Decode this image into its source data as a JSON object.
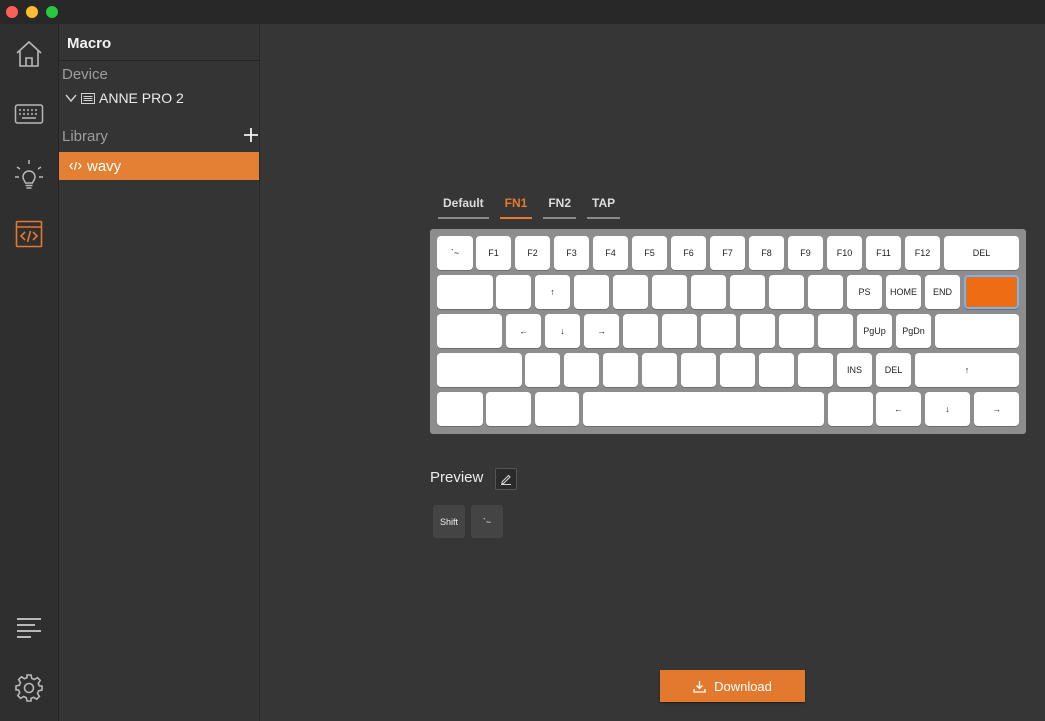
{
  "window": {
    "traffic_lights": [
      "close",
      "minimize",
      "maximize"
    ]
  },
  "nav": [
    {
      "name": "home-icon"
    },
    {
      "name": "keyboard-icon"
    },
    {
      "name": "lightbulb-icon"
    },
    {
      "name": "code-icon",
      "active": true
    },
    {
      "name": "list-icon"
    },
    {
      "name": "gear-icon"
    }
  ],
  "panel": {
    "title": "Macro",
    "device_label": "Device",
    "device_name": "ANNE PRO 2",
    "library_label": "Library",
    "library_items": [
      "wavy"
    ]
  },
  "tabs": [
    "Default",
    "FN1",
    "FN2",
    "TAP"
  ],
  "active_tab": "FN1",
  "keyboard": {
    "rows": [
      [
        "`~",
        "F1",
        "F2",
        "F3",
        "F4",
        "F5",
        "F6",
        "F7",
        "F8",
        "F9",
        "F10",
        "F11",
        "F12",
        "DEL"
      ],
      [
        "",
        "",
        "↑",
        "",
        "",
        "",
        "",
        "",
        "",
        "",
        "PS",
        "HOME",
        "END",
        ""
      ],
      [
        "",
        "←",
        "↓",
        "→",
        "",
        "",
        "",
        "",
        "",
        "",
        "PgUp",
        "PgDn",
        ""
      ],
      [
        "",
        "",
        "",
        "",
        "",
        "",
        "",
        "",
        "",
        "INS",
        "DEL",
        "↑"
      ],
      [
        "",
        "",
        "",
        "",
        "",
        "←",
        "↓",
        "→"
      ]
    ],
    "highlighted_key": "row2-col14"
  },
  "preview": {
    "label": "Preview",
    "keys": [
      "Shift",
      "`~"
    ]
  },
  "download_label": "Download",
  "colors": {
    "accent": "#e3792e",
    "highlight_key": "#ee6c14"
  }
}
